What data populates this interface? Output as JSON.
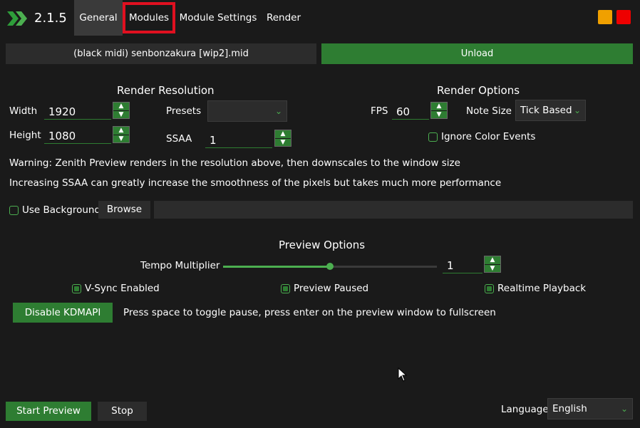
{
  "header": {
    "version": "2.1.5",
    "tabs": [
      {
        "label": "General",
        "active": true
      },
      {
        "label": "Modules",
        "highlighted": true
      },
      {
        "label": "Module Settings"
      },
      {
        "label": "Render"
      }
    ],
    "window_buttons": {
      "minimize_color": "#f0a000",
      "close_color": "#ee0000"
    }
  },
  "file": {
    "name": "(black midi) senbonzakura [wip2].mid",
    "unload_label": "Unload"
  },
  "render_resolution": {
    "title": "Render Resolution",
    "width_label": "Width",
    "width_value": "1920",
    "height_label": "Height",
    "height_value": "1080",
    "presets_label": "Presets",
    "presets_value": "",
    "ssaa_label": "SSAA",
    "ssaa_value": "1"
  },
  "render_options": {
    "title": "Render Options",
    "fps_label": "FPS",
    "fps_value": "60",
    "note_size_label": "Note Size",
    "note_size_value": "Tick Based",
    "ignore_color_events_label": "Ignore Color Events",
    "ignore_color_events_checked": false
  },
  "warnings": {
    "line1": "Warning: Zenith Preview renders in the resolution above, then downscales to the window size",
    "line2": "Increasing SSAA can greatly increase the smoothness of the pixels but takes much more performance"
  },
  "background": {
    "use_label": "Use Background",
    "checked": false,
    "browse_label": "Browse",
    "path_value": ""
  },
  "preview_options": {
    "title": "Preview Options",
    "tempo_label": "Tempo Multiplier",
    "tempo_value": "1",
    "tempo_slider_fraction": 0.5,
    "vsync_label": "V-Sync Enabled",
    "vsync_checked": true,
    "paused_label": "Preview Paused",
    "paused_checked": true,
    "realtime_label": "Realtime Playback",
    "realtime_checked": true,
    "kdmapi_label": "Disable KDMAPI",
    "hint": "Press space to toggle pause, press enter on the preview window to fullscreen"
  },
  "footer": {
    "start_label": "Start Preview",
    "stop_label": "Stop",
    "language_label": "Language",
    "language_value": "English"
  },
  "icons": {
    "logo": "zenith-chevron-logo",
    "dropdown": "chevron-down-icon",
    "stepper_up": "chevron-up-icon",
    "stepper_down": "chevron-down-icon"
  },
  "colors": {
    "accent": "#2e7d32",
    "accent_light": "#4caf50",
    "background": "#1a1a1a",
    "panel": "#2c2c2c",
    "highlight": "#e01020"
  }
}
